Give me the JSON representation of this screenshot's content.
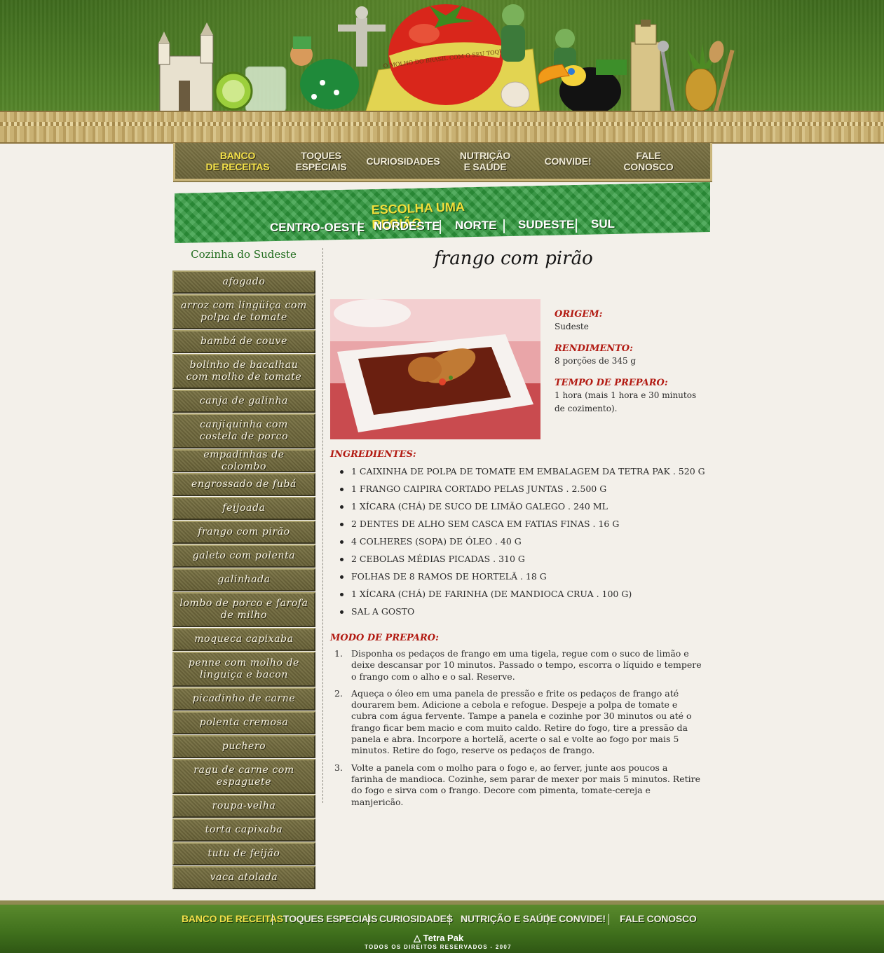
{
  "header": {
    "tomato_slogan": "O MOLHO DO BRASIL COM O SEU TOQUE"
  },
  "topnav": [
    {
      "line1": "BANCO",
      "line2": "DE RECEITAS",
      "active": true
    },
    {
      "line1": "TOQUES",
      "line2": "ESPECIAIS",
      "active": false
    },
    {
      "line1": "CURIOSIDADES",
      "line2": "",
      "active": false
    },
    {
      "line1": "NUTRIÇÃO",
      "line2": "E SAÚDE",
      "active": false
    },
    {
      "line1": "CONVIDE!",
      "line2": "",
      "active": false
    },
    {
      "line1": "FALE",
      "line2": "CONOSCO",
      "active": false
    }
  ],
  "region": {
    "title": "ESCOLHA UMA REGIÃO",
    "links": [
      "CENTRO-OESTE",
      "NORDESTE",
      "NORTE",
      "SUDESTE",
      "SUL"
    ]
  },
  "sidebar": {
    "title": "Cozinha do Sudeste",
    "recipes": [
      "afogado",
      "arroz com lingüiça com polpa de tomate",
      "bambá de couve",
      "bolinho de bacalhau com molho de tomate",
      "canja de galinha",
      "canjiquinha com costela de porco",
      "empadinhas de colombo",
      "engrossado de fubá",
      "feijoada",
      "frango com pirão",
      "galeto com polenta",
      "galinhada",
      "lombo de porco e farofa de milho",
      "moqueca capixaba",
      "penne com molho de linguiça e bacon",
      "picadinho de carne",
      "polenta cremosa",
      "puchero",
      "ragu de carne com espaguete",
      "roupa-velha",
      "torta capixaba",
      "tutu de feijão",
      "vaca atolada"
    ]
  },
  "recipe": {
    "title": "frango com pirão",
    "origem_label": "ORIGEM:",
    "origem": "Sudeste",
    "rendimento_label": "RENDIMENTO:",
    "rendimento": "8 porções de 345 g",
    "tempo_label": "TEMPO DE PREPARO:",
    "tempo": "1 hora (mais 1 hora e 30 minutos de cozimento).",
    "ingredients_label": "INGREDIENTES:",
    "ingredients": [
      "1 CAIXINHA DE POLPA DE TOMATE EM EMBALAGEM DA TETRA PAK . 520 G",
      "1 FRANGO CAIPIRA CORTADO PELAS JUNTAS . 2.500 G",
      "1 XÍCARA (CHÁ) DE SUCO DE LIMÃO GALEGO . 240 ML",
      "2 DENTES DE ALHO SEM CASCA EM FATIAS FINAS . 16 G",
      "4 COLHERES (SOPA) DE ÓLEO . 40 G",
      "2 CEBOLAS MÉDIAS PICADAS . 310 G",
      "FOLHAS DE 8 RAMOS DE HORTELÃ . 18 G",
      "1 XÍCARA (CHÁ) DE FARINHA (DE MANDIOCA CRUA . 100 G)",
      "SAL A GOSTO"
    ],
    "steps_label": "MODO DE PREPARO:",
    "steps": [
      "Disponha os pedaços de frango em uma tigela, regue com o suco de limão e deixe descansar por 10 minutos. Passado o tempo, escorra o líquido e tempere o frango com o alho e o sal. Reserve.",
      "Aqueça o óleo em uma panela de pressão e frite os pedaços de frango até dourarem bem. Adicione a cebola e refogue. Despeje a polpa de tomate e cubra com água fervente. Tampe a panela e cozinhe por 30 minutos ou até o frango ficar bem macio e com muito caldo. Retire do fogo, tire a pressão da panela e abra. Incorpore a hortelã, acerte o sal e volte ao fogo por mais 5 minutos. Retire do fogo, reserve os pedaços de frango.",
      "Volte a panela com o molho para o fogo e, ao ferver, junte aos poucos a farinha de mandioca. Cozinhe, sem parar de mexer por mais 5 minutos. Retire do fogo e sirva com o frango. Decore com pimenta, tomate-cereja e manjericão."
    ]
  },
  "footer": {
    "links": [
      "BANCO DE RECEITAS",
      "TOQUES ESPECIAIS",
      "CURIOSIDADES",
      "NUTRIÇÃO E SAÚDE",
      "CONVIDE!",
      "FALE CONOSCO"
    ],
    "brand": "Tetra Pak",
    "rights": "TODOS OS DIREITOS RESERVADOS - 2007"
  },
  "colors": {
    "accent_red": "#b21a12",
    "nav_yellow": "#f4e14a",
    "brand_green": "#2e9a3c"
  }
}
